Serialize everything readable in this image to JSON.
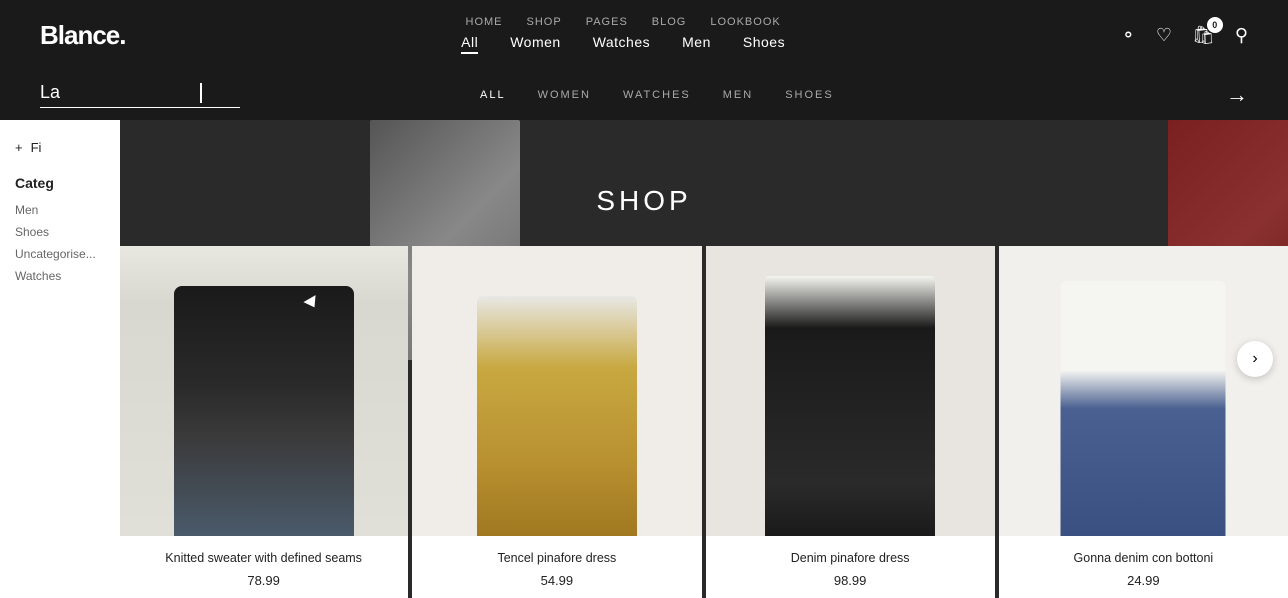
{
  "logo": {
    "text": "Blance."
  },
  "nav": {
    "top_links": [
      {
        "label": "HOME"
      },
      {
        "label": "SHOP"
      },
      {
        "label": "PAGES"
      },
      {
        "label": "BLOG"
      },
      {
        "label": "LOOKBOOK"
      }
    ],
    "bottom_links": [
      {
        "label": "All",
        "active": true
      },
      {
        "label": "Women"
      },
      {
        "label": "Watches"
      },
      {
        "label": "Men"
      },
      {
        "label": "Shoes"
      }
    ],
    "cart_count": "0"
  },
  "search": {
    "input_value": "La",
    "filters": [
      {
        "label": "ALL",
        "active": true
      },
      {
        "label": "WOMEN"
      },
      {
        "label": "WATCHES"
      },
      {
        "label": "MEN"
      },
      {
        "label": "SHOES"
      }
    ],
    "arrow_label": "→"
  },
  "hero": {
    "shop_label": "Shop"
  },
  "sidebar": {
    "filter_label": "Fi",
    "categories_title": "Categ",
    "items": [
      {
        "label": "Men"
      },
      {
        "label": "Shoes"
      },
      {
        "label": "Uncategorise..."
      },
      {
        "label": "Watches"
      }
    ]
  },
  "products": [
    {
      "name": "Knitted sweater with defined seams",
      "price": "78.99",
      "image_type": "sweater"
    },
    {
      "name": "Tencel pinafore dress",
      "price": "54.99",
      "image_type": "pinafore"
    },
    {
      "name": "Denim pinafore dress",
      "price": "98.99",
      "image_type": "denim-dress"
    },
    {
      "name": "Gonna denim con bottoni",
      "price": "24.99",
      "image_type": "gonna"
    }
  ]
}
